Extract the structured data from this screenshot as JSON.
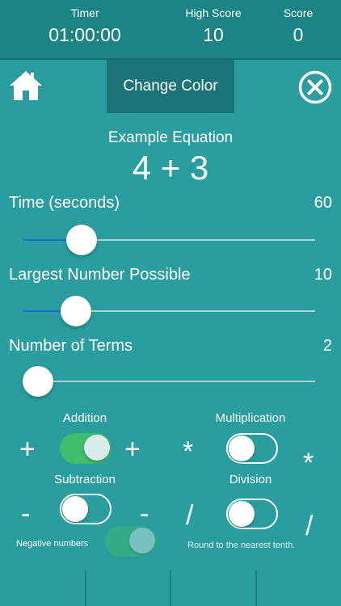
{
  "header": {
    "timer_label": "Timer",
    "timer_value": "01:00:00",
    "high_score_label": "High Score",
    "high_score_value": "10",
    "score_label": "Score",
    "score_value": "0"
  },
  "toolbar": {
    "home_icon": "home-icon",
    "change_color_label": "Change Color",
    "close_icon": "close-circle-icon"
  },
  "example": {
    "label": "Example Equation",
    "equation": "4 + 3"
  },
  "settings": {
    "time": {
      "label": "Time (seconds)",
      "value": "60",
      "fraction": 0.15
    },
    "largest": {
      "label": "Largest Number Possible",
      "value": "10",
      "fraction": 0.13
    },
    "terms": {
      "label": "Number of Terms",
      "value": "2",
      "fraction": 0.0
    }
  },
  "operations": {
    "addition": {
      "label": "Addition",
      "symbol": "+",
      "on": true
    },
    "multiplication": {
      "label": "Multiplication",
      "symbol": "*",
      "on": false
    },
    "subtraction": {
      "label": "Subtraction",
      "symbol": "-",
      "on": false
    },
    "division": {
      "label": "Division",
      "symbol": "/",
      "on": false
    }
  },
  "options": {
    "negative_numbers": {
      "label": "Negative numbers",
      "on": true,
      "disabled": true
    },
    "round_note": "Round to the nearest tenth."
  },
  "colors": {
    "background": "#2a9d9f",
    "header": "#1d8486",
    "button": "#1b7476",
    "toggle_on": "#3fbd6b",
    "slider_fill": "#1f6fd6"
  }
}
